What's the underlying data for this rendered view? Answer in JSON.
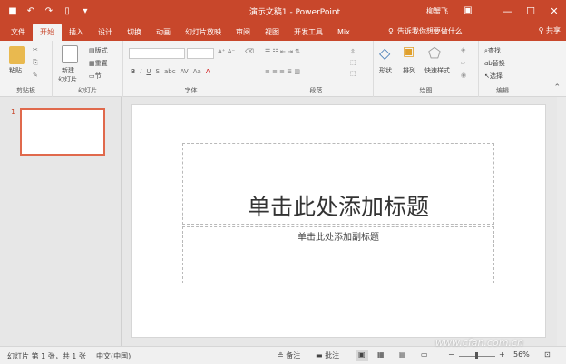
{
  "titlebar": {
    "title": "演示文稿1 - PowerPoint",
    "user": "柳蟹飞",
    "icons": [
      "save-icon",
      "undo-icon",
      "redo-icon",
      "new-icon",
      "customize-qat-icon"
    ]
  },
  "tabs": [
    "文件",
    "开始",
    "插入",
    "设计",
    "切换",
    "动画",
    "幻灯片放映",
    "审阅",
    "视图",
    "开发工具",
    "Mix"
  ],
  "active_tab": "开始",
  "tellme": "告诉我你想要做什么",
  "share": "共享",
  "ribbon": {
    "clipboard": {
      "paste": "粘贴",
      "label": "剪贴板"
    },
    "slides": {
      "new_slide": "新建",
      "new_slide2": "幻灯片",
      "layout": "版式",
      "reset": "重置",
      "section": "节",
      "label": "幻灯片"
    },
    "font": {
      "label": "字体",
      "bold": "B",
      "italic": "I",
      "underline": "U",
      "strike": "S",
      "shadow": "abc",
      "spacing": "AV",
      "case": "Aa",
      "color": "A"
    },
    "paragraph": {
      "label": "段落"
    },
    "drawing": {
      "shapes": "形状",
      "arrange": "排列",
      "quick_styles": "快速样式",
      "label": "绘图"
    },
    "editing": {
      "find": "查找",
      "replace": "替换",
      "select": "选择",
      "label": "编辑"
    }
  },
  "slides_pane": {
    "slide_number": "1"
  },
  "slide": {
    "title_placeholder": "单击此处添加标题",
    "subtitle_placeholder": "单击此处添加副标题"
  },
  "statusbar": {
    "slide_info": "幻灯片 第 1 张，共 1 张",
    "language": "中文(中国)",
    "notes": "备注",
    "comments": "批注",
    "zoom": "56%"
  },
  "watermark": "www.cfan.com.cn",
  "colors": {
    "accent": "#c8472b",
    "thumb_border": "#e0694c"
  }
}
